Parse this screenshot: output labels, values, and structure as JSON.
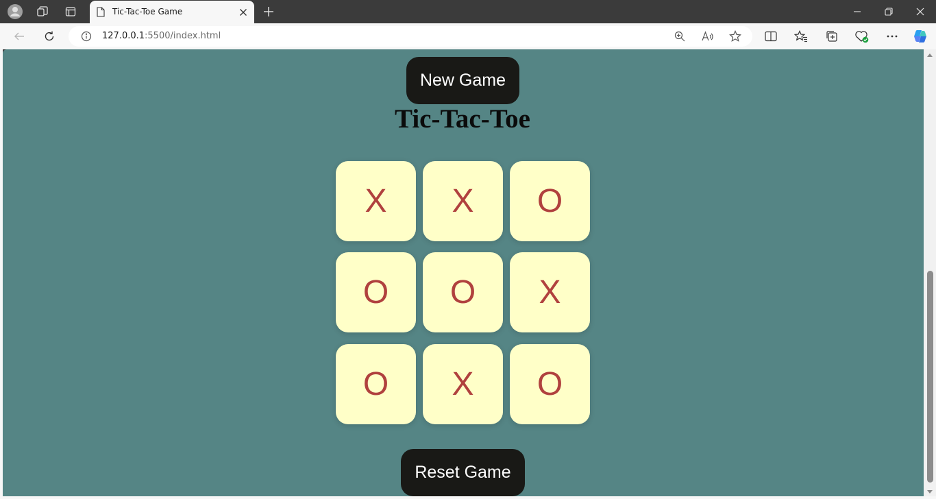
{
  "browser": {
    "tab_title": "Tic-Tac-Toe Game",
    "url_host": "127.0.0.1",
    "url_rest": ":5500/index.html"
  },
  "page": {
    "new_game_label": "New Game",
    "title": "Tic-Tac-Toe",
    "reset_label": "Reset Game",
    "board": [
      "X",
      "X",
      "O",
      "O",
      "O",
      "X",
      "O",
      "X",
      "O"
    ]
  },
  "colors": {
    "page_background": "#558585",
    "cell_background": "#ffffc8",
    "mark_color": "#b0413e",
    "button_background": "#191916"
  }
}
